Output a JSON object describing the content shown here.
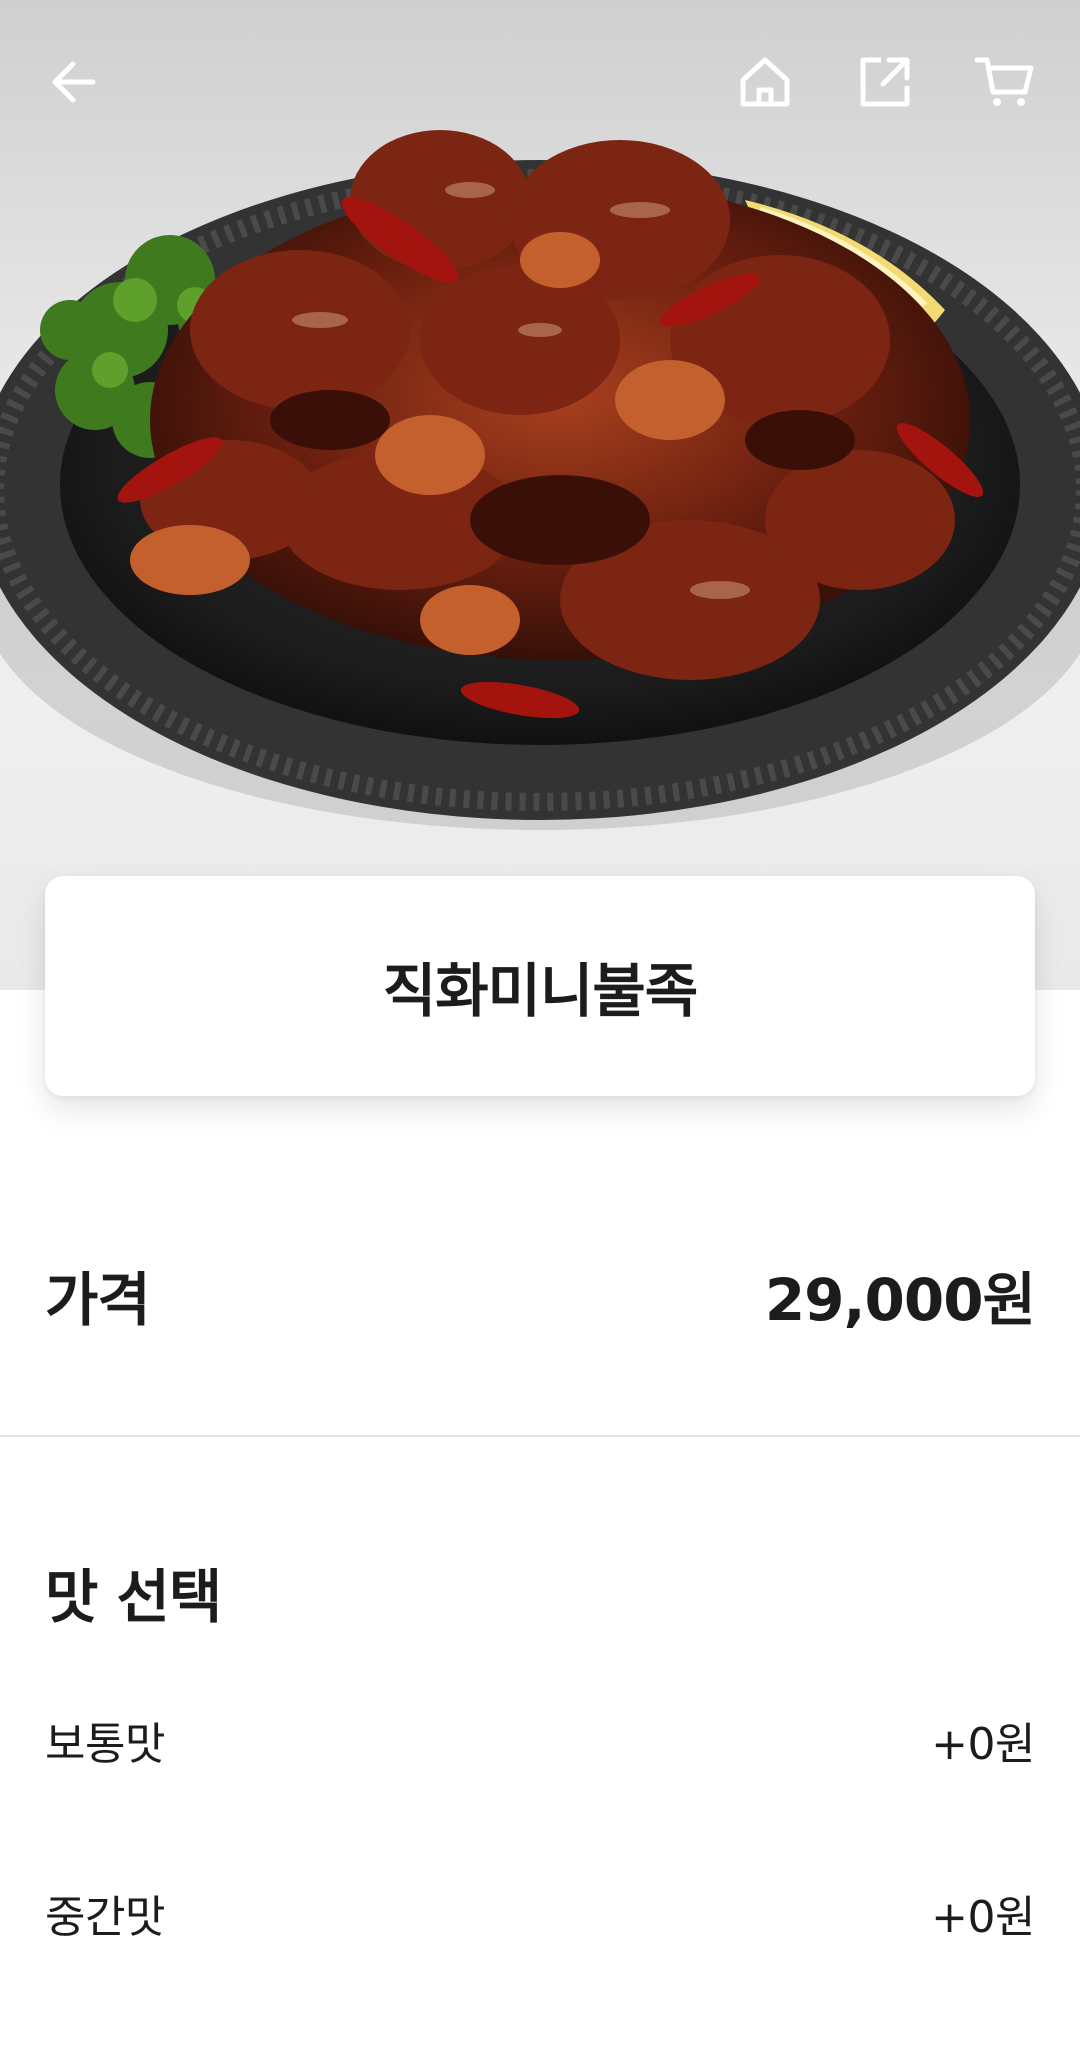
{
  "topbar": {
    "icons": [
      "back-arrow-icon",
      "home-icon",
      "share-icon",
      "cart-icon"
    ]
  },
  "product": {
    "name": "직화미니불족",
    "image": "plate of spicy glazed pork feet with parsley and lemon"
  },
  "price": {
    "label": "가격",
    "value": "29,000원"
  },
  "flavor": {
    "title": "맛 선택",
    "options": [
      {
        "name": "보통맛",
        "extra": "+0원"
      },
      {
        "name": "중간맛",
        "extra": "+0원"
      }
    ]
  },
  "colors": {
    "text": "#1c1c1c",
    "divider": "#e3e3e3",
    "icon": "#ffffff"
  }
}
